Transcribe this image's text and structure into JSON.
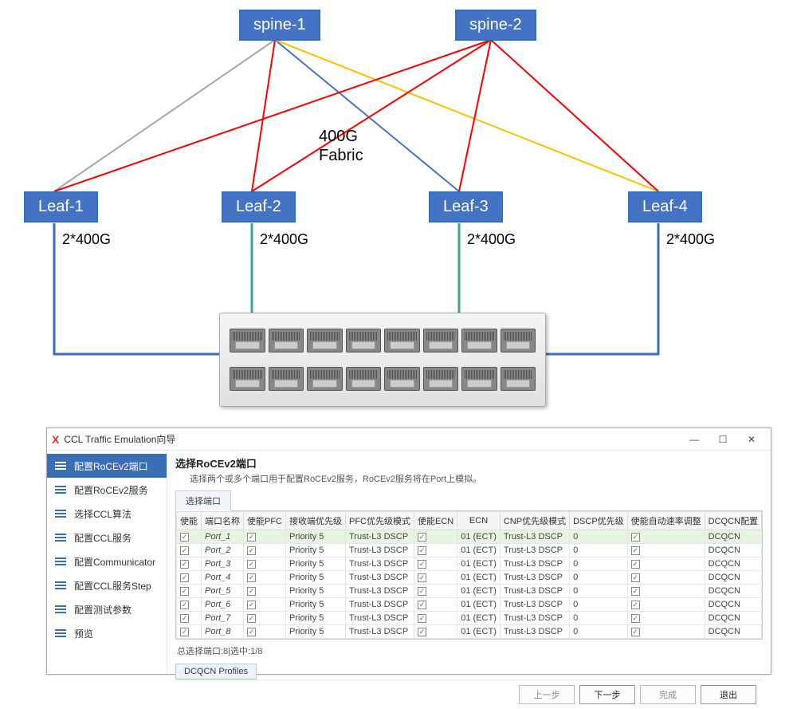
{
  "diagram": {
    "spine1": "spine-1",
    "spine2": "spine-2",
    "leaf1": "Leaf-1",
    "leaf2": "Leaf-2",
    "leaf3": "Leaf-3",
    "leaf4": "Leaf-4",
    "fabric_line1": "400G",
    "fabric_line2": "Fabric",
    "link_bw": "2*400G"
  },
  "dialog": {
    "app_icon": "X",
    "title": "CCL Traffic Emulation向导",
    "sidenav": [
      "配置RoCEv2端口",
      "配置RoCEv2服务",
      "选择CCL算法",
      "配置CCL服务",
      "配置Communicator",
      "配置CCL服务Step",
      "配置测试参数",
      "预览"
    ],
    "section_title": "选择RoCEv2端口",
    "section_sub": "选择两个或多个端口用于配置RoCEv2服务，RoCEv2服务将在Port上模拟。",
    "tab": "选择端口",
    "columns": [
      "使能",
      "端口名称",
      "使能PFC",
      "接收端优先级",
      "PFC优先级模式",
      "使能ECN",
      "ECN",
      "CNP优先级模式",
      "DSCP优先级",
      "使能自动速率调整",
      "DCQCN配置"
    ],
    "rows": [
      {
        "name": "Port_1",
        "rx_pri": "Priority 5",
        "pfc": "Trust-L3 DSCP",
        "ecn": "01 (ECT)",
        "cnp": "Trust-L3 DSCP",
        "dscp": "0",
        "dcqcn": "DCQCN"
      },
      {
        "name": "Port_2",
        "rx_pri": "Priority 5",
        "pfc": "Trust-L3 DSCP",
        "ecn": "01 (ECT)",
        "cnp": "Trust-L3 DSCP",
        "dscp": "0",
        "dcqcn": "DCQCN"
      },
      {
        "name": "Port_3",
        "rx_pri": "Priority 5",
        "pfc": "Trust-L3 DSCP",
        "ecn": "01 (ECT)",
        "cnp": "Trust-L3 DSCP",
        "dscp": "0",
        "dcqcn": "DCQCN"
      },
      {
        "name": "Port_4",
        "rx_pri": "Priority 5",
        "pfc": "Trust-L3 DSCP",
        "ecn": "01 (ECT)",
        "cnp": "Trust-L3 DSCP",
        "dscp": "0",
        "dcqcn": "DCQCN"
      },
      {
        "name": "Port_5",
        "rx_pri": "Priority 5",
        "pfc": "Trust-L3 DSCP",
        "ecn": "01 (ECT)",
        "cnp": "Trust-L3 DSCP",
        "dscp": "0",
        "dcqcn": "DCQCN"
      },
      {
        "name": "Port_6",
        "rx_pri": "Priority 5",
        "pfc": "Trust-L3 DSCP",
        "ecn": "01 (ECT)",
        "cnp": "Trust-L3 DSCP",
        "dscp": "0",
        "dcqcn": "DCQCN"
      },
      {
        "name": "Port_7",
        "rx_pri": "Priority 5",
        "pfc": "Trust-L3 DSCP",
        "ecn": "01 (ECT)",
        "cnp": "Trust-L3 DSCP",
        "dscp": "0",
        "dcqcn": "DCQCN"
      },
      {
        "name": "Port_8",
        "rx_pri": "Priority 5",
        "pfc": "Trust-L3 DSCP",
        "ecn": "01 (ECT)",
        "cnp": "Trust-L3 DSCP",
        "dscp": "0",
        "dcqcn": "DCQCN"
      }
    ],
    "status": "总选择端口:8|选中:1/8",
    "profiles_btn": "DCQCN Profiles",
    "footer": {
      "prev": "上一步",
      "next": "下一步",
      "finish": "完成",
      "cancel": "退出"
    }
  }
}
